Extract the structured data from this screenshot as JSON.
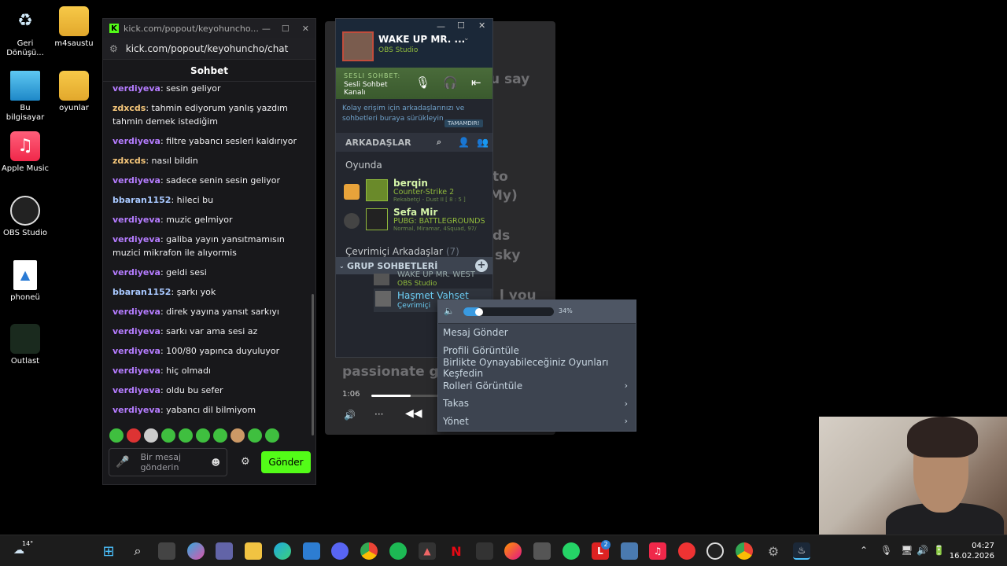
{
  "desktop": {
    "icons": [
      {
        "name": "recycle-bin",
        "label": "Geri Dönüşü..."
      },
      {
        "name": "m4saustu-folder",
        "label": "m4saustu"
      },
      {
        "name": "this-pc",
        "label": "Bu bilgisayar"
      },
      {
        "name": "oyunlar-folder",
        "label": "oyunlar"
      },
      {
        "name": "apple-music",
        "label": "Apple Music"
      },
      {
        "name": "obs-studio",
        "label": "OBS Studio"
      },
      {
        "name": "phoneu",
        "label": "phoneü"
      },
      {
        "name": "outlast",
        "label": "Outlast"
      }
    ]
  },
  "kick": {
    "window_title": "kick.com/popout/keyohuncho...",
    "url": "kick.com/popout/keyohuncho/chat",
    "chat_title": "Sohbet",
    "messages": [
      {
        "user": "verdiyeva",
        "text": ": sesin geliyor",
        "color": "#b57cff"
      },
      {
        "user": "zdxcds",
        "text": ": tahmin ediyorum yanlış yazdım tahmin demek istediğim",
        "color": "#f6c77a"
      },
      {
        "user": "verdiyeva",
        "text": ": filtre yabancı sesleri kaldırıyor",
        "color": "#b57cff"
      },
      {
        "user": "zdxcds",
        "text": ": nasıl bildin",
        "color": "#f6c77a"
      },
      {
        "user": "verdiyeva",
        "text": ": sadece senin sesin geliyor",
        "color": "#b57cff"
      },
      {
        "user": "bbaran1152",
        "text": ": hileci bu",
        "color": "#a8c8ff"
      },
      {
        "user": "verdiyeva",
        "text": ": muzic gelmiyor",
        "color": "#b57cff"
      },
      {
        "user": "verdiyeva",
        "text": ": galiba yayın yansıtmamısın muzici mikrafon ile alıyormis",
        "color": "#b57cff"
      },
      {
        "user": "verdiyeva",
        "text": ": geldi sesi",
        "color": "#b57cff"
      },
      {
        "user": "bbaran1152",
        "text": ": şarkı yok",
        "color": "#a8c8ff"
      },
      {
        "user": "verdiyeva",
        "text": ": direk yayına yansıt sarkıyı",
        "color": "#b57cff"
      },
      {
        "user": "verdiyeva",
        "text": ": sarkı var ama sesi az",
        "color": "#b57cff"
      },
      {
        "user": "verdiyeva",
        "text": ": 100/80 yapınca duyuluyor",
        "color": "#b57cff"
      },
      {
        "user": "verdiyeva",
        "text": ": hiç olmadı",
        "color": "#b57cff"
      },
      {
        "user": "verdiyeva",
        "text": ": oldu bu sefer",
        "color": "#b57cff"
      },
      {
        "user": "verdiyeva",
        "text": ": yabancı dil bilmiyom",
        "color": "#b57cff"
      }
    ],
    "input_placeholder": "Bir mesaj gönderin",
    "send_label": "Gönder"
  },
  "player": {
    "lyrics": [
      {
        "text": "u say"
      },
      {
        "text": "to"
      },
      {
        "text": "My)"
      },
      {
        "text": "ds"
      },
      {
        "text": "sky"
      },
      {
        "text": "l you"
      },
      {
        "text": "passionate g"
      }
    ],
    "time_elapsed": "1:06",
    "progress_fraction": 0.45
  },
  "steam": {
    "user_name": "WAKE UP MR. ...",
    "user_status": "OBS Studio",
    "voice_label": "SESLI SOHBET:",
    "voice_channel": "Sesli Sohbet Kanalı",
    "hint": "Kolay erişim için arkadaşlarınızı ve sohbetleri buraya sürükleyin",
    "done_label": "TAMAMDIR!",
    "friends_header": "ARKADAŞLAR",
    "ingame_header": "Oyunda",
    "friends": [
      {
        "name": "berqin",
        "game": "Counter-Strike 2",
        "detail": "Rekabetçi - Dust II [ 8 : 5 ]"
      },
      {
        "name": "Sefa Mir",
        "game": "PUBG: BATTLEGROUNDS",
        "detail": "Normal, Miramar, 4Squad, 97/"
      }
    ],
    "online_header": "Çevrimiçi Arkadaşlar",
    "online_count": "(7)",
    "group_header": "GRUP SOHBETLERİ",
    "group_members": [
      {
        "name": "WAKE UP MR. WEST",
        "status": "OBS Studio"
      },
      {
        "name": "Haşmet Vahşet",
        "status": "Çevrimiçi"
      }
    ]
  },
  "context_menu": {
    "volume_percent": "34%",
    "volume_level": 0.34,
    "items": [
      {
        "label": "Mesaj Gönder",
        "submenu": false
      },
      {
        "label": "Profili Görüntüle",
        "submenu": false
      },
      {
        "label": "Birlikte Oynayabileceğiniz Oyunları Keşfedin",
        "submenu": false
      },
      {
        "label": "Rolleri Görüntüle",
        "submenu": true
      },
      {
        "label": "Takas",
        "submenu": true
      },
      {
        "label": "Yönet",
        "submenu": true
      }
    ]
  },
  "taskbar": {
    "weather": "14°",
    "time": "04:27",
    "date": "16.02.2026",
    "badge_count": "2"
  }
}
